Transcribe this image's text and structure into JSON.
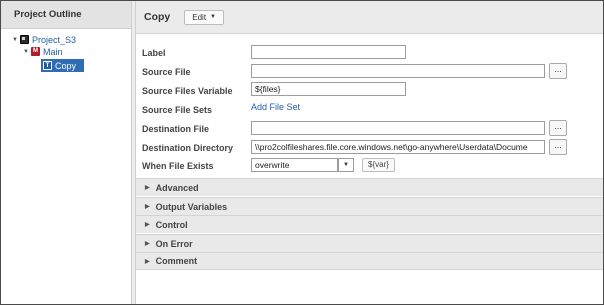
{
  "outline": {
    "header": "Project Outline",
    "project": {
      "label": "Project_S3"
    },
    "module": {
      "label": "Main"
    },
    "task": {
      "label": "Copy"
    }
  },
  "task_panel": {
    "title": "Copy",
    "edit_label": "Edit"
  },
  "form": {
    "label": {
      "label": "Label",
      "value": ""
    },
    "source_file": {
      "label": "Source File",
      "value": "",
      "browse": "..."
    },
    "source_files_variable": {
      "label": "Source Files Variable",
      "value": "${files}"
    },
    "source_file_sets": {
      "label": "Source File Sets",
      "link": "Add File Set"
    },
    "destination_file": {
      "label": "Destination File",
      "value": "",
      "browse": "..."
    },
    "destination_directory": {
      "label": "Destination Directory",
      "value": "\\\\pro2colfileshares.file.core.windows.net\\go-anywhere\\Userdata\\Docume",
      "browse": "..."
    },
    "when_file_exists": {
      "label": "When File Exists",
      "value": "overwrite",
      "var_button": "${var}"
    }
  },
  "sections": [
    {
      "label": "Advanced"
    },
    {
      "label": "Output Variables"
    },
    {
      "label": "Control"
    },
    {
      "label": "On Error"
    },
    {
      "label": "Comment"
    }
  ],
  "colors": {
    "selected_bg": "#2f6db5",
    "link": "#1f5fa8",
    "module_icon": "#b01b2e"
  }
}
